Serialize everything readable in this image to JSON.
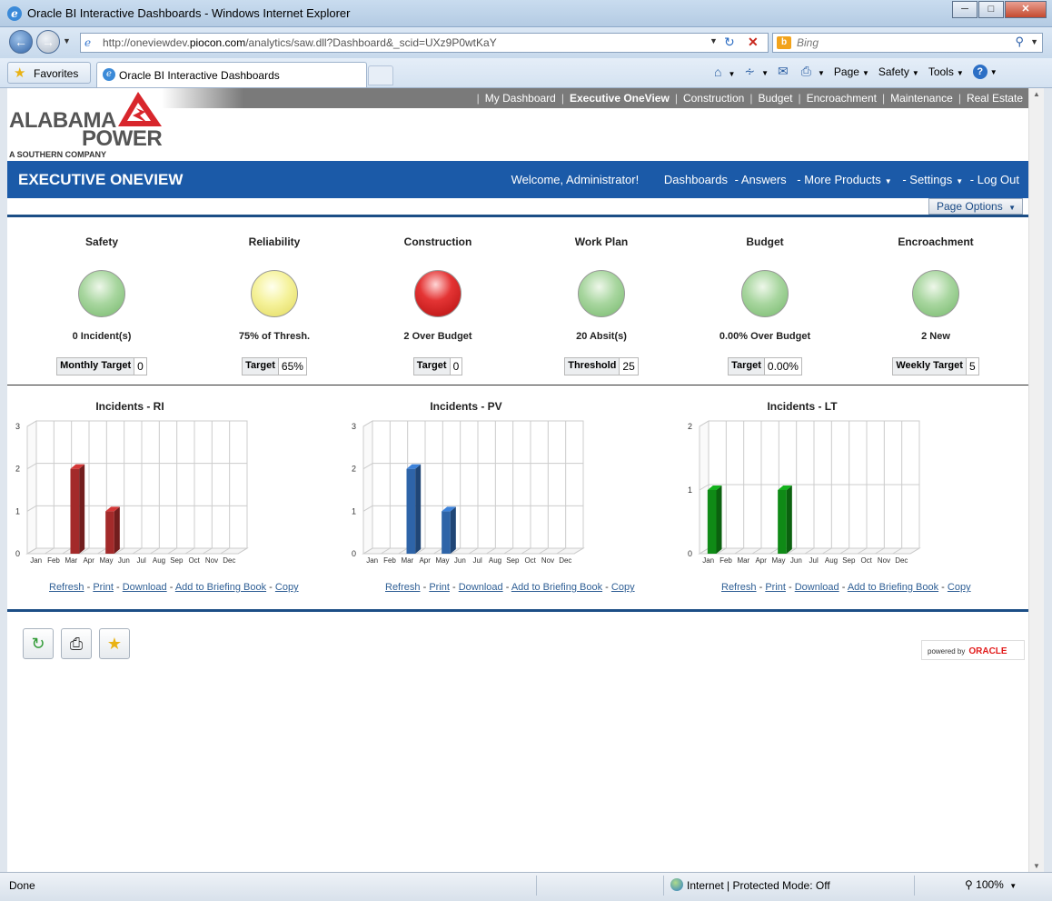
{
  "window": {
    "title": "Oracle BI Interactive Dashboards - Windows Internet Explorer"
  },
  "addressbar": {
    "url_prefix": "http://oneviewdev.",
    "url_domain": "piocon.com",
    "url_suffix": "/analytics/saw.dll?Dashboard&_scid=UXz9P0wtKaY",
    "search_placeholder": "Bing"
  },
  "tabbar": {
    "favorites_label": "Favorites",
    "tab_label": "Oracle BI Interactive Dashboards",
    "page_label": "Page",
    "safety_label": "Safety",
    "tools_label": "Tools"
  },
  "topnav": {
    "items": [
      "My Dashboard",
      "Executive OneView",
      "Construction",
      "Budget",
      "Encroachment",
      "Maintenance",
      "Real Estate"
    ],
    "active": "Executive OneView"
  },
  "logo": {
    "line1": "ALABAMA",
    "line2": "POWER",
    "line3": "A SOUTHERN COMPANY",
    "brand_color": "#d8262c"
  },
  "header": {
    "title": "EXECUTIVE ONEVIEW",
    "welcome": "Welcome, Administrator!",
    "dashboards": "Dashboards",
    "answers": "- Answers",
    "more_products": "- More Products",
    "settings": "- Settings",
    "logout": "- Log Out",
    "page_options": "Page Options"
  },
  "kpis": [
    {
      "name": "Safety",
      "status": "green",
      "value": "0 Incident(s)",
      "target_label": "Monthly Target",
      "target_value": "0"
    },
    {
      "name": "Reliability",
      "status": "yellow",
      "value": "75% of Thresh.",
      "target_label": "Target",
      "target_value": "65%"
    },
    {
      "name": "Construction",
      "status": "red",
      "value": "2 Over Budget",
      "target_label": "Target",
      "target_value": "0"
    },
    {
      "name": "Work Plan",
      "status": "green",
      "value": "20 Absit(s)",
      "target_label": "Threshold",
      "target_value": "25"
    },
    {
      "name": "Budget",
      "status": "green",
      "value": "0.00% Over Budget",
      "target_label": "Target",
      "target_value": "0.00%"
    },
    {
      "name": "Encroachment",
      "status": "green",
      "value": "2 New",
      "target_label": "Weekly Target",
      "target_value": "5"
    }
  ],
  "chart_links": {
    "refresh": "Refresh",
    "print": "Print",
    "download": "Download",
    "briefing": "Add to Briefing Book",
    "copy": "Copy"
  },
  "chart_data": [
    {
      "type": "bar",
      "title": "Incidents - RI",
      "categories": [
        "Jan",
        "Feb",
        "Mar",
        "Apr",
        "May",
        "Jun",
        "Jul",
        "Aug",
        "Sep",
        "Oct",
        "Nov",
        "Dec"
      ],
      "values": [
        0,
        0,
        2,
        0,
        1,
        0,
        0,
        0,
        0,
        0,
        0,
        0
      ],
      "ylim": [
        0,
        3
      ],
      "yticks": [
        0,
        1,
        2,
        3
      ],
      "color": "#a32a2a",
      "grid": true
    },
    {
      "type": "bar",
      "title": "Incidents - PV",
      "categories": [
        "Jan",
        "Feb",
        "Mar",
        "Apr",
        "May",
        "Jun",
        "Jul",
        "Aug",
        "Sep",
        "Oct",
        "Nov",
        "Dec"
      ],
      "values": [
        0,
        0,
        2,
        0,
        1,
        0,
        0,
        0,
        0,
        0,
        0,
        0
      ],
      "ylim": [
        0,
        3
      ],
      "yticks": [
        0,
        1,
        2,
        3
      ],
      "color": "#2e64a8",
      "grid": true
    },
    {
      "type": "bar",
      "title": "Incidents - LT",
      "categories": [
        "Jan",
        "Feb",
        "Mar",
        "Apr",
        "May",
        "Jun",
        "Jul",
        "Aug",
        "Sep",
        "Oct",
        "Nov",
        "Dec"
      ],
      "values": [
        1,
        0,
        0,
        0,
        1,
        0,
        0,
        0,
        0,
        0,
        0,
        0
      ],
      "ylim": [
        0,
        2
      ],
      "yticks": [
        0,
        1,
        2
      ],
      "color": "#0f8a16",
      "grid": true
    }
  ],
  "footer": {
    "powered_by": "powered by",
    "oracle": "ORACLE"
  },
  "statusbar": {
    "status": "Done",
    "zone": "Internet | Protected Mode: Off",
    "zoom": "100%"
  }
}
